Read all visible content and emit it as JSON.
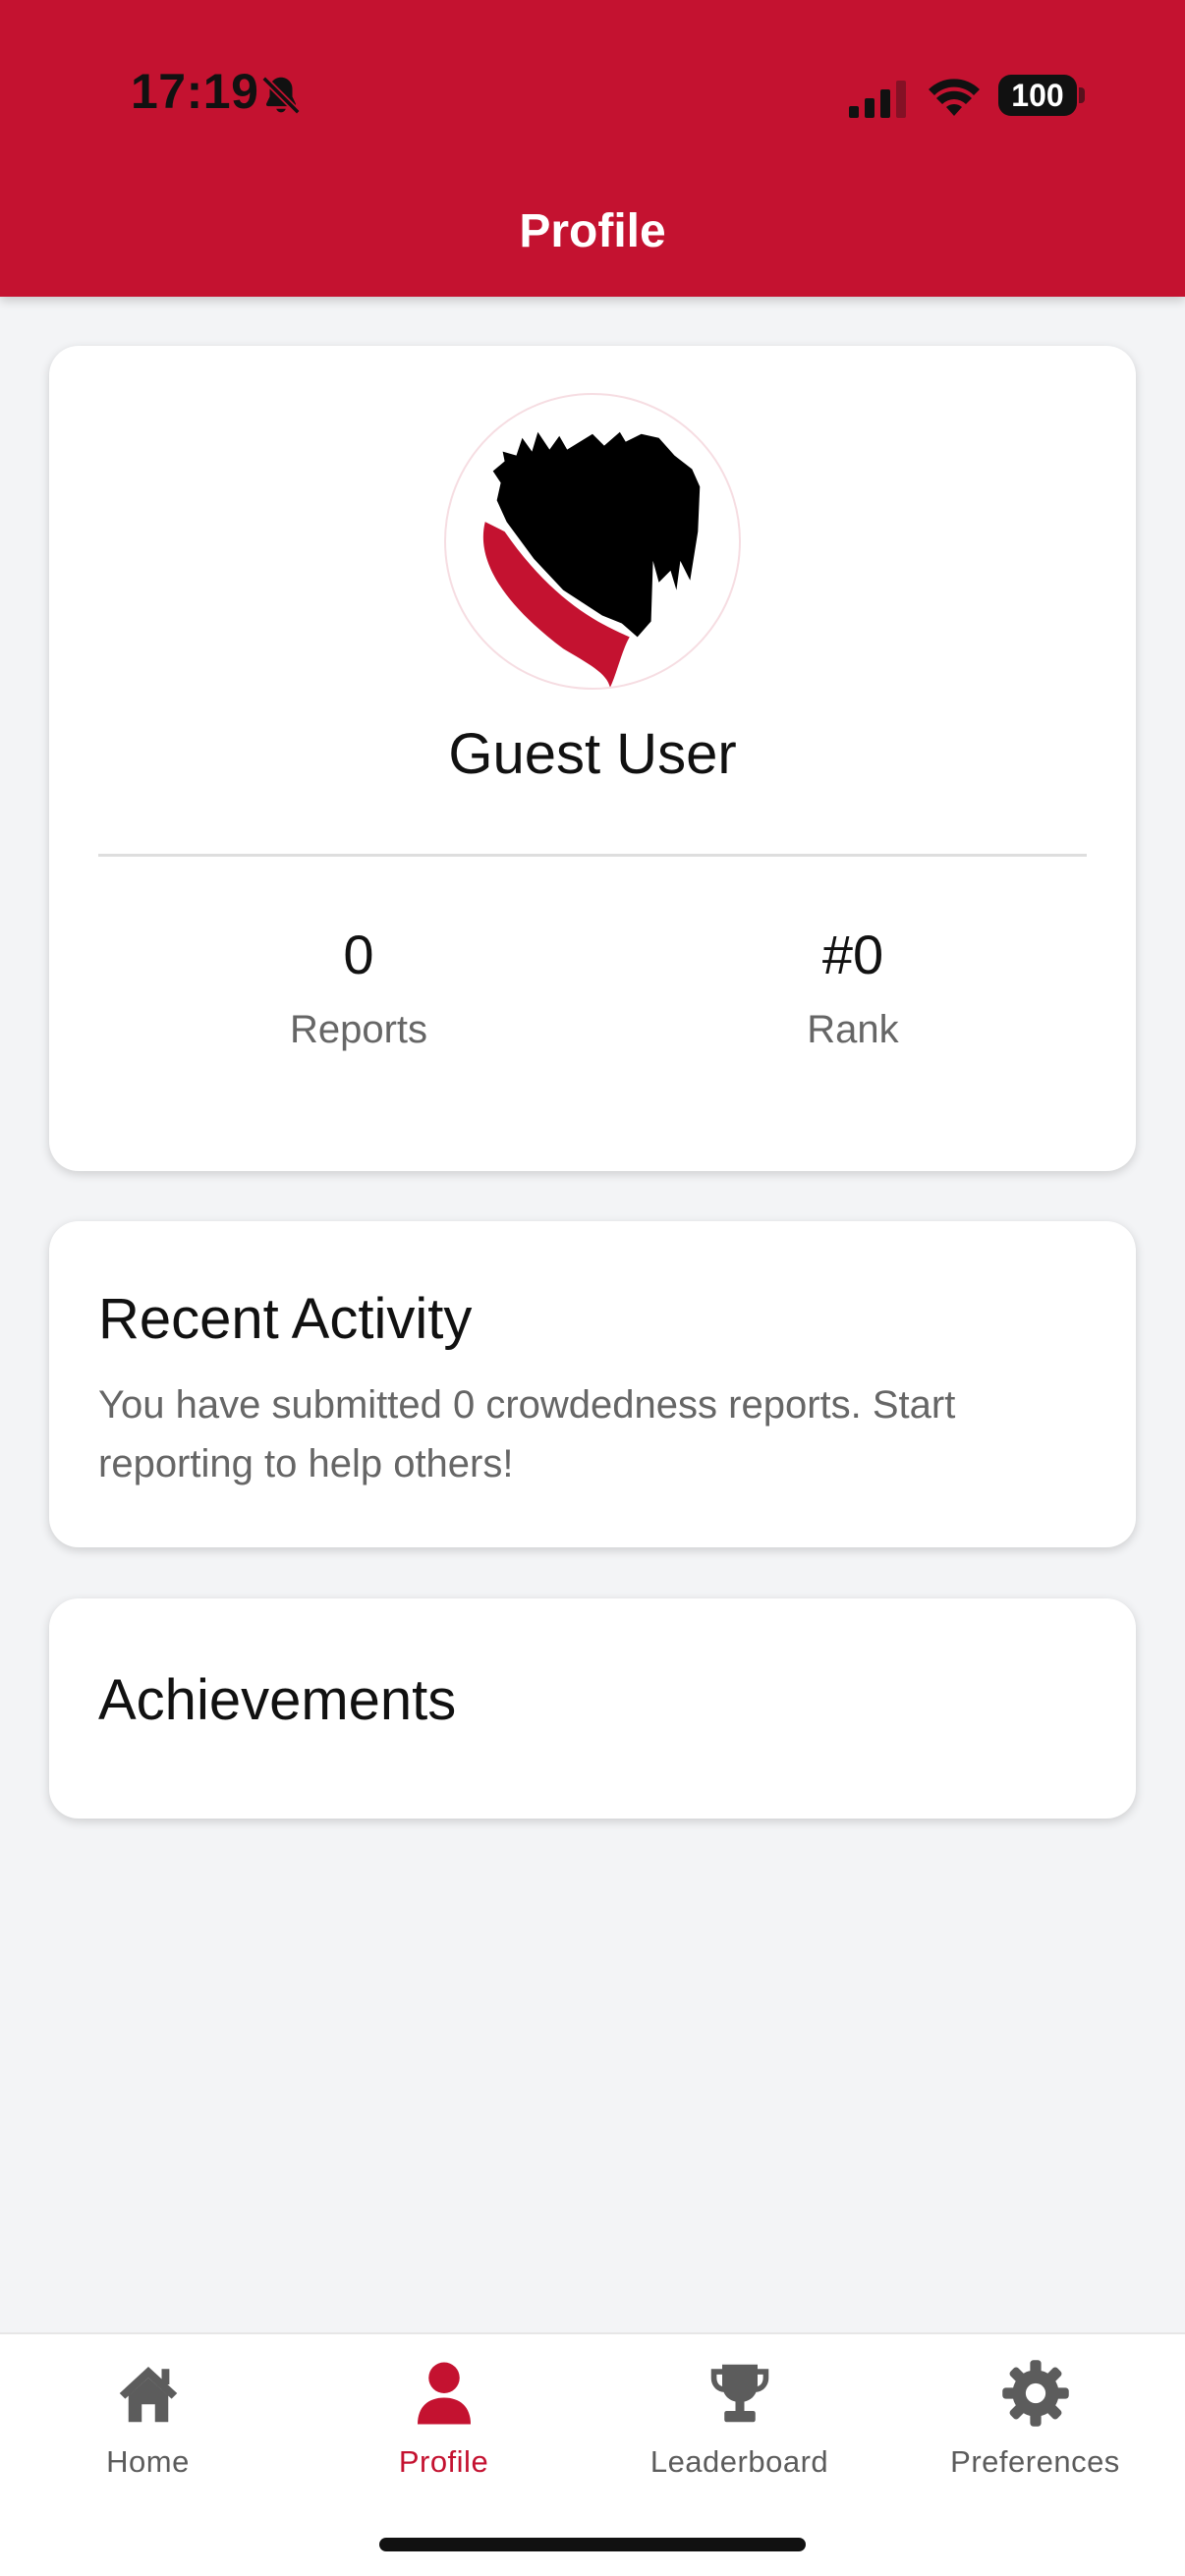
{
  "status_bar": {
    "time": "17:19",
    "battery": "100",
    "icons": [
      "bell-slash-icon",
      "cellular-signal-icon",
      "wifi-icon",
      "battery-icon"
    ]
  },
  "header": {
    "title": "Profile"
  },
  "profile": {
    "avatar_icon": "scottie-dog-icon",
    "name": "Guest User",
    "stats": [
      {
        "value": "0",
        "label": "Reports"
      },
      {
        "value": "#0",
        "label": "Rank"
      }
    ]
  },
  "recent_activity": {
    "title": "Recent Activity",
    "text": "You have submitted 0 crowdedness reports. Start reporting to help others!"
  },
  "achievements": {
    "title": "Achievements"
  },
  "nav": {
    "items": [
      {
        "label": "Home",
        "icon": "home-icon"
      },
      {
        "label": "Profile",
        "icon": "person-icon",
        "active": true
      },
      {
        "label": "Leaderboard",
        "icon": "trophy-icon"
      },
      {
        "label": "Preferences",
        "icon": "gear-icon"
      }
    ]
  },
  "colors": {
    "brand": "#c41230",
    "background": "#f3f4f6",
    "card": "#ffffff",
    "nav_inactive": "#5c5c5c"
  }
}
